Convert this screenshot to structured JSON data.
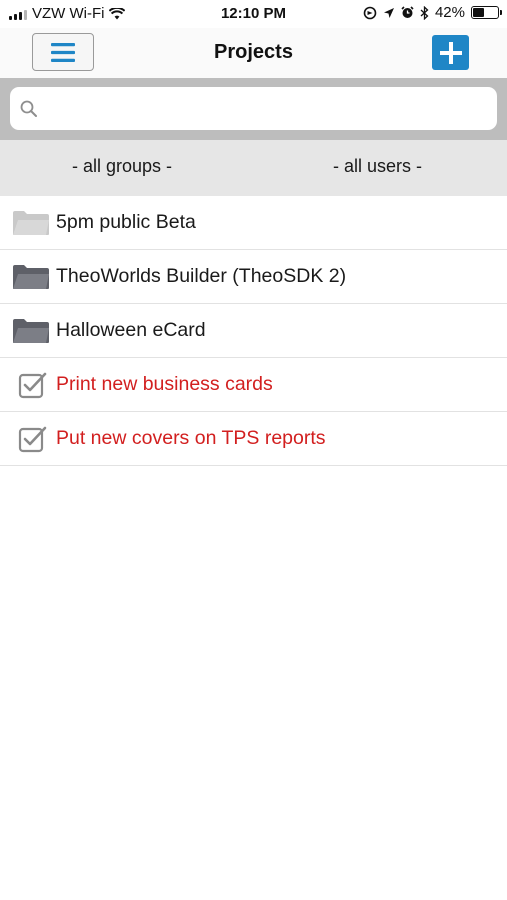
{
  "status_bar": {
    "carrier": "VZW Wi-Fi",
    "time": "12:10 PM",
    "battery_text": "42%",
    "battery_level": 0.42,
    "icons": [
      "wifi-icon",
      "location-lock-icon",
      "location-arrow-icon",
      "alarm-icon",
      "bluetooth-icon",
      "battery-icon"
    ]
  },
  "nav": {
    "title": "Projects",
    "menu_icon": "hamburger-menu-icon",
    "add_icon": "plus-icon"
  },
  "search": {
    "placeholder": "",
    "value": ""
  },
  "filters": {
    "groups": "- all groups -",
    "users": "- all users -"
  },
  "colors": {
    "accent": "#1f86c6",
    "todo_text": "#d21f1f",
    "muted_text": "#8c8c8c",
    "filter_bg": "#e6e6e6",
    "search_bg": "#bdbdbd"
  },
  "items": [
    {
      "label": "5pm public Beta",
      "icon": "folder-icon",
      "style": "muted"
    },
    {
      "label": "TheoWorlds Builder (TheoSDK 2)",
      "icon": "folder-icon",
      "style": "folder"
    },
    {
      "label": "Halloween eCard",
      "icon": "folder-icon",
      "style": "folder"
    },
    {
      "label": "Print new business cards",
      "icon": "checkbox-icon",
      "style": "todo"
    },
    {
      "label": "Put new covers on TPS reports",
      "icon": "checkbox-icon",
      "style": "todo"
    }
  ]
}
